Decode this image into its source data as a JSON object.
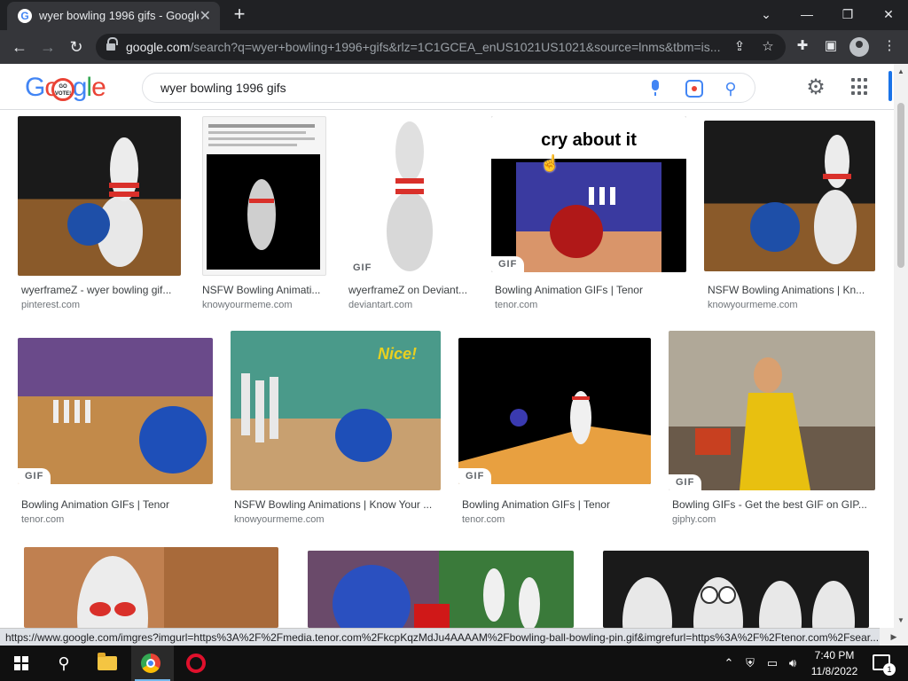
{
  "tab": {
    "title": "wyer bowling 1996 gifs - Google",
    "close": "✕",
    "new_tab": "+"
  },
  "window": {
    "minimize": "—",
    "restore": "❐",
    "close": "✕",
    "tab_search": "⌄"
  },
  "address_bar": {
    "host": "google.com",
    "path": "/search?q=wyer+bowling+1996+gifs&rlz=1C1GCEA_enUS1021US1021&source=lnms&tbm=is..."
  },
  "google": {
    "logo_letters": [
      "G",
      "o",
      "o",
      "g",
      "l",
      "e"
    ],
    "doodle_text": "GO VOTE!",
    "query": "wyer bowling 1996 gifs"
  },
  "results": [
    {
      "title": "wyerframeZ - wyer bowling gif...",
      "source": "pinterest.com",
      "gif": false
    },
    {
      "title": "NSFW Bowling Animati...",
      "source": "knowyourmeme.com",
      "gif": false
    },
    {
      "title": "wyerframeZ on Deviant...",
      "source": "deviantart.com",
      "gif": true
    },
    {
      "title": "Bowling Animation GIFs | Tenor",
      "source": "tenor.com",
      "gif": true,
      "caption": "cry about it"
    },
    {
      "title": "NSFW Bowling Animations | Kn...",
      "source": "knowyourmeme.com",
      "gif": false
    },
    {
      "title": "Bowling Animation GIFs | Tenor",
      "source": "tenor.com",
      "gif": true
    },
    {
      "title": "NSFW Bowling Animations | Know Your ...",
      "source": "knowyourmeme.com",
      "gif": false,
      "caption": "Nice!"
    },
    {
      "title": "Bowling Animation GIFs | Tenor",
      "source": "tenor.com",
      "gif": true
    },
    {
      "title": "Bowling GIFs - Get the best GIF on GIP...",
      "source": "giphy.com",
      "gif": true
    },
    {
      "title": "",
      "source": "",
      "gif": false
    },
    {
      "title": "",
      "source": "",
      "gif": false
    },
    {
      "title": "",
      "source": "",
      "gif": false
    }
  ],
  "gif_badge": "GIF",
  "status_url": "https://www.google.com/imgres?imgurl=https%3A%2F%2Fmedia.tenor.com%2FkcpKqzMdJu4AAAAM%2Fbowling-ball-bowling-pin.gif&imgrefurl=https%3A%2F%2Ftenor.com%2Fsear...",
  "taskbar": {
    "time": "7:40 PM",
    "date": "11/8/2022",
    "notification_count": "1"
  },
  "colors": {
    "chrome_dark": "#202124",
    "chrome_toolbar": "#35363a",
    "google_blue": "#4285f4",
    "taskbar": "#101010"
  }
}
